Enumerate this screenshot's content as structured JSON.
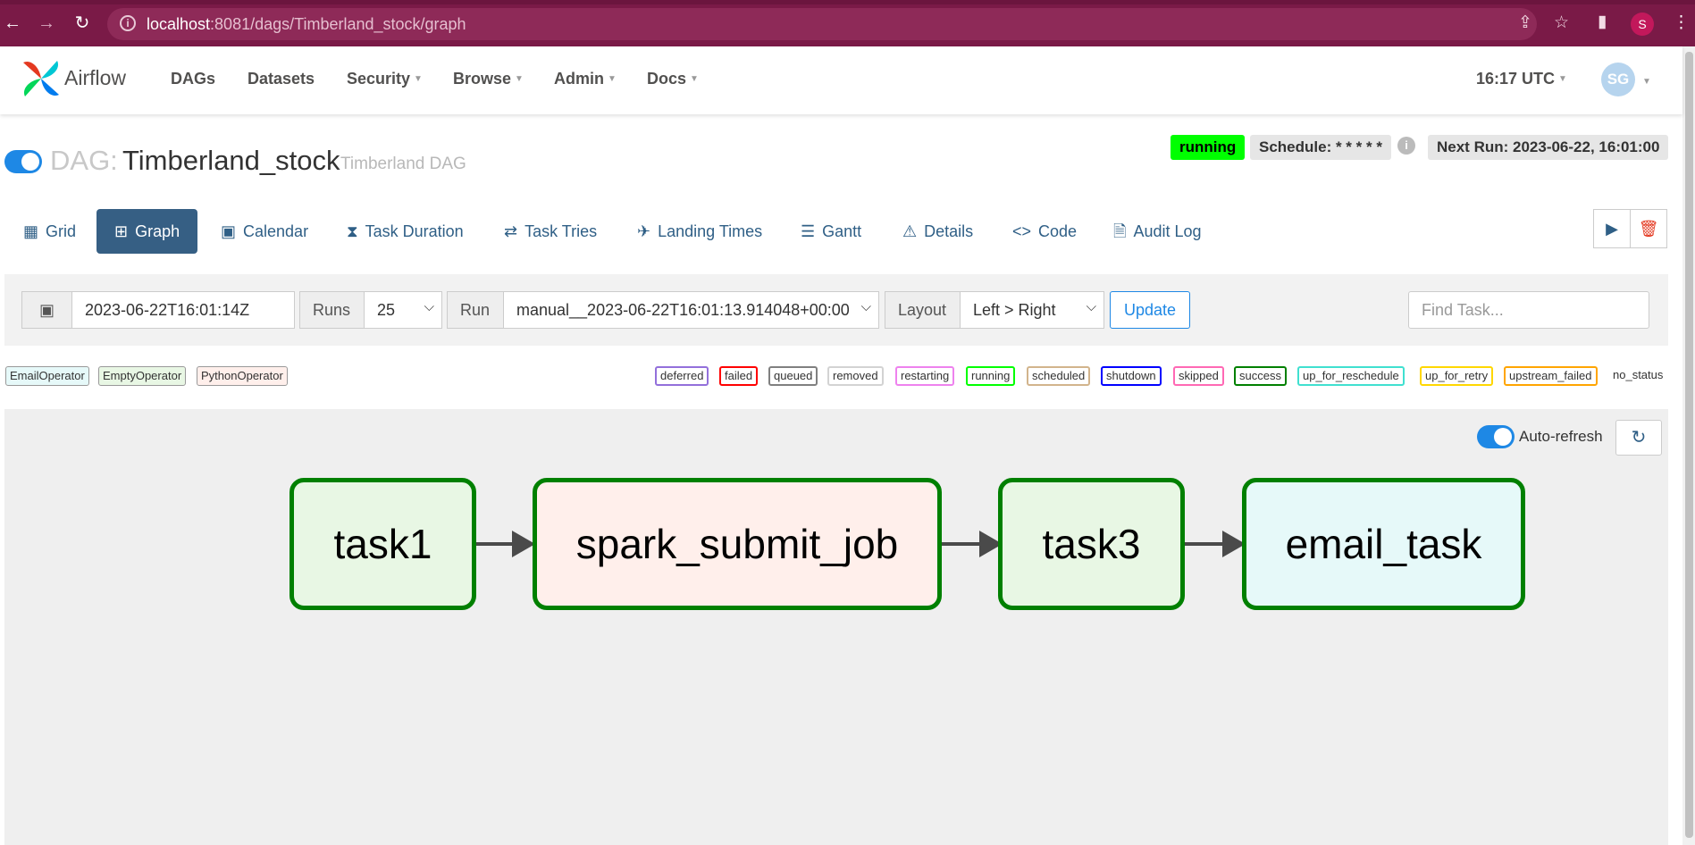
{
  "browser": {
    "url_host": "localhost",
    "url_path": ":8081/dags/Timberland_stock/graph",
    "profile_initial": "S"
  },
  "navbar": {
    "brand": "Airflow",
    "menu": [
      "DAGs",
      "Datasets",
      "Security",
      "Browse",
      "Admin",
      "Docs"
    ],
    "time": "16:17 UTC",
    "user_initials": "SG"
  },
  "dag": {
    "prefix": "DAG:",
    "id": "Timberland_stock",
    "description": "Timberland DAG",
    "state": "running",
    "schedule": "Schedule: * * * * *",
    "next_run": "Next Run: 2023-06-22, 16:01:00"
  },
  "tabs": [
    {
      "label": "Grid",
      "icon": "grid-icon"
    },
    {
      "label": "Graph",
      "icon": "graph-icon"
    },
    {
      "label": "Calendar",
      "icon": "calendar-icon"
    },
    {
      "label": "Task Duration",
      "icon": "hourglass-icon"
    },
    {
      "label": "Task Tries",
      "icon": "retry-icon"
    },
    {
      "label": "Landing Times",
      "icon": "landing-icon"
    },
    {
      "label": "Gantt",
      "icon": "gantt-icon"
    },
    {
      "label": "Details",
      "icon": "warning-icon"
    },
    {
      "label": "Code",
      "icon": "code-icon"
    },
    {
      "label": "Audit Log",
      "icon": "audit-log-icon"
    }
  ],
  "filters": {
    "date": "2023-06-22T16:01:14Z",
    "runs_label": "Runs",
    "runs_value": "25",
    "run_label": "Run",
    "run_value": "manual__2023-06-22T16:01:13.914048+00:00",
    "layout_label": "Layout",
    "layout_value": "Left > Right",
    "update_label": "Update",
    "find_placeholder": "Find Task..."
  },
  "legend": {
    "operators": [
      {
        "label": "EmailOperator",
        "color": "#e6f9f9"
      },
      {
        "label": "EmptyOperator",
        "color": "#e8f7e4"
      },
      {
        "label": "PythonOperator",
        "color": "#ffefeb"
      }
    ],
    "statuses": [
      {
        "label": "deferred",
        "color": "#9370db"
      },
      {
        "label": "failed",
        "color": "#ff0000"
      },
      {
        "label": "queued",
        "color": "#808080"
      },
      {
        "label": "removed",
        "color": "#d3d3d3"
      },
      {
        "label": "restarting",
        "color": "#ee82ee"
      },
      {
        "label": "running",
        "color": "#00ff00"
      },
      {
        "label": "scheduled",
        "color": "#d2b48c"
      },
      {
        "label": "shutdown",
        "color": "#0000ff"
      },
      {
        "label": "skipped",
        "color": "#ff69b4"
      },
      {
        "label": "success",
        "color": "#008000"
      },
      {
        "label": "up_for_reschedule",
        "color": "#40e0d0"
      },
      {
        "label": "up_for_retry",
        "color": "#ffd700"
      },
      {
        "label": "upstream_failed",
        "color": "#ffa500"
      }
    ],
    "no_status": "no_status"
  },
  "graph": {
    "auto_refresh_label": "Auto-refresh",
    "tasks": [
      {
        "id": "task1",
        "fill": "#e8f7e4",
        "state_color": "#008000"
      },
      {
        "id": "spark_submit_job",
        "fill": "#ffefeb",
        "state_color": "#008000"
      },
      {
        "id": "task3",
        "fill": "#e8f7e4",
        "state_color": "#008000"
      },
      {
        "id": "email_task",
        "fill": "#e6f9f9",
        "state_color": "#008000"
      }
    ]
  },
  "colors": {
    "browser_bar": "#7a1a47",
    "accent": "#1e88e5",
    "active_tab": "#365f84"
  }
}
